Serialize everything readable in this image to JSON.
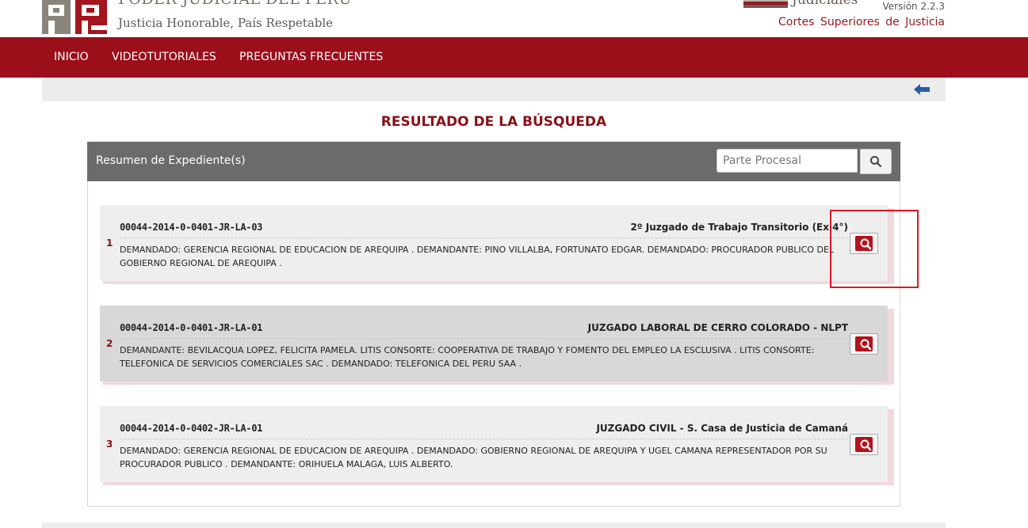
{
  "header": {
    "org_name": "PODER JUDICIAL DEL PERÚ",
    "motto": "Justicia Honorable, País Respetable",
    "system_title": "Judiciales",
    "version": "Versión 2.2.3",
    "cortes": "Cortes Superiores de Justicia",
    "brand_color": "#9a0f1a"
  },
  "nav": {
    "items": [
      {
        "label": "INICIO"
      },
      {
        "label": "VIDEOTUTORIALES"
      },
      {
        "label": "PREGUNTAS FRECUENTES"
      }
    ]
  },
  "subbar": {
    "back_icon": "arrow-left-icon"
  },
  "page_title": "RESULTADO DE LA BÚSQUEDA",
  "panel": {
    "title": "Resumen de Expediente(s)",
    "search_placeholder": "Parte Procesal",
    "search_icon": "search-icon"
  },
  "results": [
    {
      "num": "1",
      "expediente": "00044-2014-0-0401-JR-LA-03",
      "juzgado": "2º Juzgado de Trabajo Transitorio (Ex 4°)",
      "partes": "DEMANDADO: GERENCIA REGIONAL DE EDUCACION DE AREQUIPA . DEMANDANTE: PINO VILLALBA, FORTUNATO EDGAR. DEMANDADO: PROCURADOR PUBLICO DEL GOBIERNO REGIONAL DE AREQUIPA ."
    },
    {
      "num": "2",
      "expediente": "00044-2014-0-0401-JR-LA-01",
      "juzgado": "JUZGADO LABORAL DE CERRO COLORADO - NLPT",
      "partes": "DEMANDANTE: BEVILACQUA LOPEZ, FELICITA PAMELA. LITIS CONSORTE: COOPERATIVA DE TRABAJO Y FOMENTO DEL EMPLEO LA ESCLUSIVA . LITIS CONSORTE: TELEFONICA DE SERVICIOS COMERCIALES SAC . DEMANDADO: TELEFONICA DEL PERU SAA ."
    },
    {
      "num": "3",
      "expediente": "00044-2014-0-0402-JR-LA-01",
      "juzgado": "JUZGADO CIVIL - S. Casa de Justicia de Camaná",
      "partes": "DEMANDADO: GERENCIA REGIONAL DE EDUCACION DE AREQUIPA . DEMANDADO: GOBIERNO REGIONAL DE AREQUIPA Y UGEL CAMANA REPRESENTADOR POR SU PROCURADOR PUBLICO . DEMANDANTE: ORIHUELA MALAGA, LUIS ALBERTO."
    }
  ]
}
